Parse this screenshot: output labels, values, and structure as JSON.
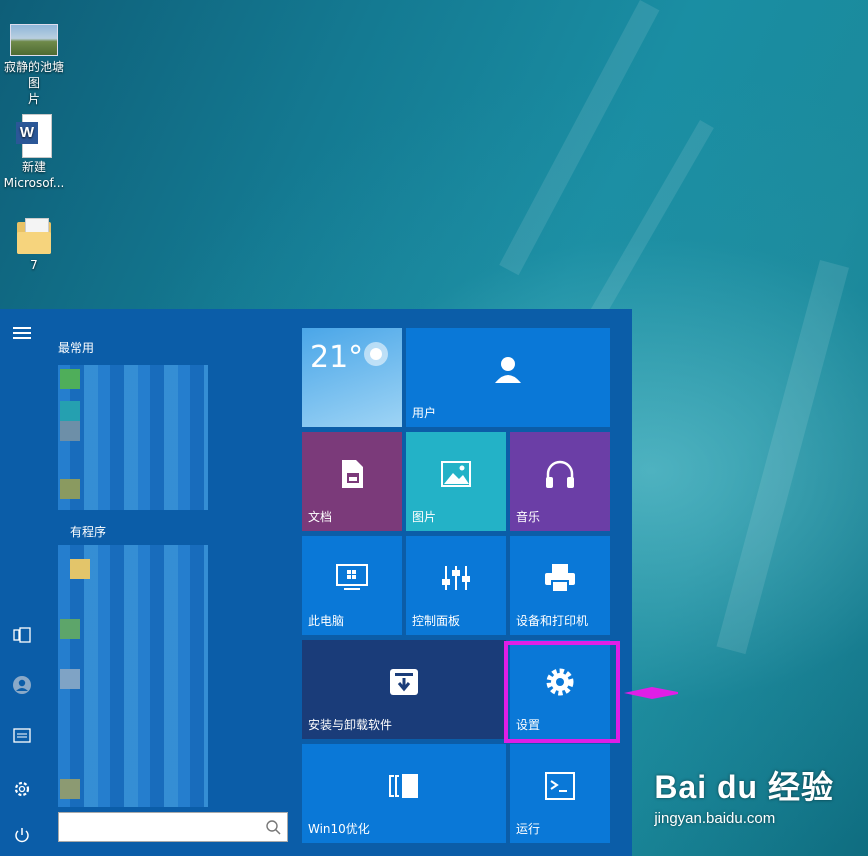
{
  "desktop": {
    "icons": [
      {
        "label_line1": "寂静的池塘图",
        "label_line2": "片",
        "icon": "photo-icon"
      },
      {
        "label_line1": "新建",
        "label_line2": "Microsof...",
        "icon": "word-document-icon"
      },
      {
        "label_line1": "7",
        "label_line2": "",
        "icon": "folder-icon"
      }
    ]
  },
  "start_menu": {
    "rail": [
      "hamburger-menu-icon",
      "tablet-mode-icon",
      "user-account-icon",
      "documents-icon",
      "settings-gear-icon",
      "power-icon"
    ],
    "most_used_label": "最常用",
    "all_apps_label": "有程序",
    "search_placeholder": "",
    "tiles": {
      "weather": {
        "temp": "21°"
      },
      "user": {
        "label": "用户"
      },
      "documents": {
        "label": "文档"
      },
      "pictures": {
        "label": "图片"
      },
      "music": {
        "label": "音乐"
      },
      "this_pc": {
        "label": "此电脑"
      },
      "control_panel": {
        "label": "控制面板"
      },
      "devices_printers": {
        "label": "设备和打印机"
      },
      "install_uninstall": {
        "label": "安装与卸载软件"
      },
      "settings": {
        "label": "设置"
      },
      "win10_optimize": {
        "label": "Win10优化"
      },
      "run": {
        "label": "运行"
      }
    }
  },
  "colors": {
    "start_bg": "#0b5da8",
    "tile_blue": "#0a78d7",
    "tile_purple": "#7b3a7a",
    "tile_teal": "#23b2c7",
    "tile_violet": "#6b3ea6",
    "tile_dark": "#1a3c79",
    "highlight": "#e01ee6"
  },
  "watermark": {
    "brand": "Bai du 经验",
    "site": "jingyan.baidu.com"
  }
}
